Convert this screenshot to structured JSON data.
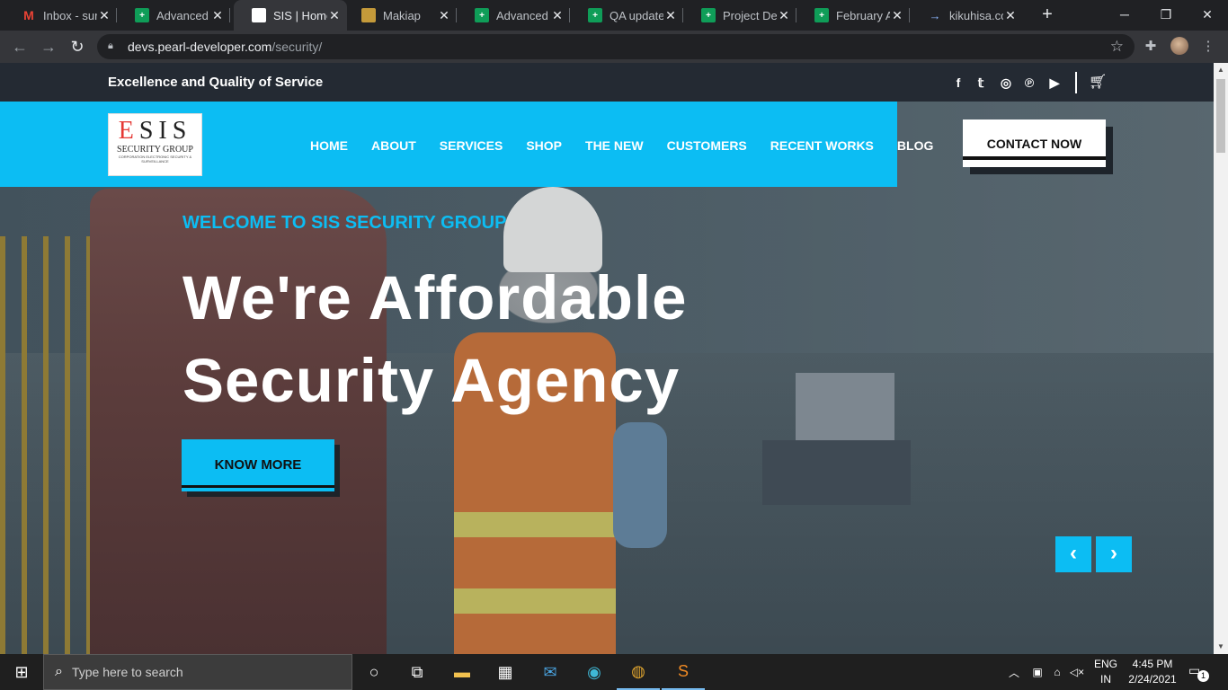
{
  "browser": {
    "tabs": [
      {
        "title": "Inbox - sura",
        "icon": "gmail-icon",
        "fav": "gmail"
      },
      {
        "title": "Advanced D",
        "icon": "sheets-icon",
        "fav": "sheet"
      },
      {
        "title": "SIS | Home",
        "icon": "sis-icon",
        "fav": "sis",
        "active": true
      },
      {
        "title": "Makiap",
        "icon": "makiap-icon",
        "fav": "mak"
      },
      {
        "title": "Advanced D",
        "icon": "sheets-icon",
        "fav": "sheet"
      },
      {
        "title": "QA update",
        "icon": "sheets-icon",
        "fav": "sheet"
      },
      {
        "title": "Project Deta",
        "icon": "sheets-icon",
        "fav": "sheet"
      },
      {
        "title": "February Ac",
        "icon": "sheets-icon",
        "fav": "sheet"
      },
      {
        "title": "kikuhisa.con",
        "icon": "kikuhisa-icon",
        "fav": "kik"
      }
    ],
    "url_domain": "devs.pearl-developer.com",
    "url_path": "/security/"
  },
  "site": {
    "tagline": "Excellence and Quality of Service",
    "logo": {
      "title_first": "E",
      "title_rest": "SIS",
      "subtitle": "SECURITY GROUP",
      "fine_print": "CORPORATION ELECTRONIC SECURITY & SURVEILLANCE"
    },
    "nav": [
      "HOME",
      "ABOUT",
      "SERVICES",
      "SHOP",
      "THE NEW",
      "CUSTOMERS",
      "RECENT WORKS",
      "BLOG"
    ],
    "contact_label": "CONTACT NOW",
    "social_icons": [
      "facebook-icon",
      "twitter-icon",
      "instagram-icon",
      "pinterest-icon",
      "youtube-icon"
    ],
    "hero": {
      "welcome": "WELCOME TO SIS SECURITY GROUP",
      "line1": "We're Affordable",
      "line2": "Security Agency",
      "button": "KNOW MORE"
    },
    "colors": {
      "accent": "#0cbdf3",
      "topbar": "#242a33"
    }
  },
  "taskbar": {
    "search_placeholder": "Type here to search",
    "lang_line1": "ENG",
    "lang_line2": "IN",
    "time": "4:45 PM",
    "date": "2/24/2021",
    "notification_count": "1"
  }
}
